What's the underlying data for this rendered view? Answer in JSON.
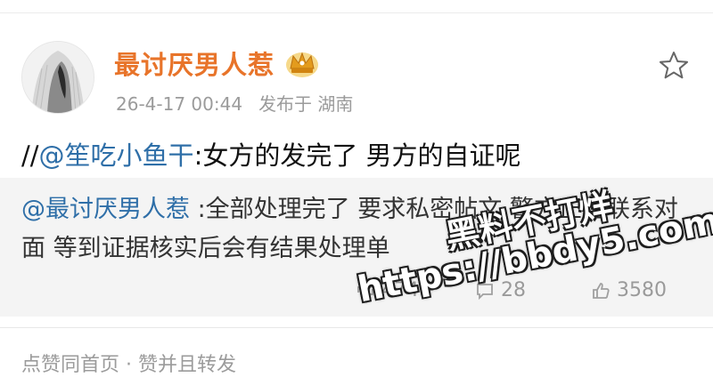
{
  "post": {
    "username": "最讨厌男人惹",
    "timestamp": "26-4-17 00:44",
    "location": "发布于 湖南",
    "text_prefix": "//",
    "mention": "@笙吃小鱼干",
    "text_body": ":女方的发完了 男方的自证呢"
  },
  "repost": {
    "mention": "@最讨厌男人惹",
    "text": " :全部处理完了 要求私密帖文 警方正在联系对面 等到证据核实后会有结果处理单",
    "reposts": "474",
    "comments": "28",
    "likes": "3580"
  },
  "footer": {
    "text": "点赞同首页 · 赞并且转发"
  },
  "watermark": {
    "line1": "黑料不打烊",
    "line2": "https://bbdy5.com"
  },
  "icons": {
    "crown": "crown-badge-icon",
    "star": "star-icon",
    "repost": "repost-icon",
    "comment": "comment-icon",
    "like": "like-icon"
  },
  "colors": {
    "username": "#e8742a",
    "mention": "#2f6fa8",
    "repost_bg": "#f4f4f4",
    "meta": "#9b9b9b"
  }
}
